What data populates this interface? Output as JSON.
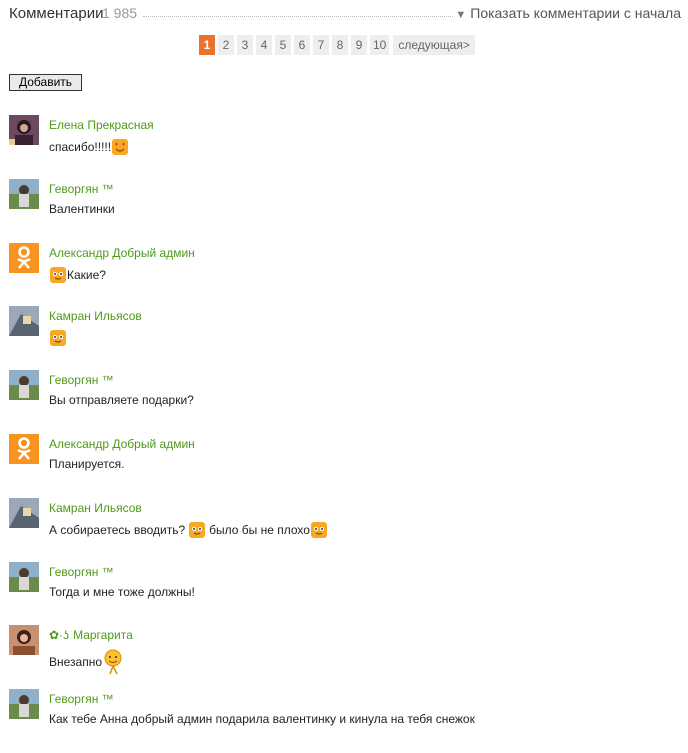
{
  "header": {
    "title": "Комментарии",
    "count": "1 985",
    "show_from_start": "Показать комментарии с начала"
  },
  "pager": {
    "pages": [
      "1",
      "2",
      "3",
      "4",
      "5",
      "6",
      "7",
      "8",
      "9",
      "10"
    ],
    "active": "1",
    "next": "следующая>"
  },
  "add_button": "Добавить",
  "comments": [
    {
      "author": "Елена Прекрасная",
      "text": "спасибо!!!!!",
      "emoji_after": "heart-eyes-emoji"
    },
    {
      "author": "Геворгян ™",
      "text": "Валентинки"
    },
    {
      "author": "Александр Добрый админ",
      "text": "Какие?",
      "emoji_before": "smiley-emoji"
    },
    {
      "author": "Камран Ильясов",
      "text": "",
      "emoji_before": "smiley-emoji"
    },
    {
      "author": "Геворгян ™",
      "text": "Вы отправляете подарки?"
    },
    {
      "author": "Александр Добрый админ",
      "text": "Планируется."
    },
    {
      "author": "Камран Ильясов",
      "text": "А собираетесь вводить?",
      "text2": "было бы не плохо",
      "emoji_mid": "smiley-emoji",
      "emoji_after": "smiley-emoji"
    },
    {
      "author": "Геворгян ™",
      "text": "Тогда и мне тоже должны!"
    },
    {
      "author": "Маргарита",
      "author_prefix": "✿·ʖ",
      "text": "Внезапно",
      "emoji_after": "dancing-emoji"
    },
    {
      "author": "Геворгян ™",
      "text": "Как тебе Анна добрый админ подарила валентинку и кинула на тебя снежок"
    }
  ],
  "colors": {
    "accent": "#eb722e",
    "author": "#4f9a1a",
    "ok_orange": "#f7931e"
  }
}
